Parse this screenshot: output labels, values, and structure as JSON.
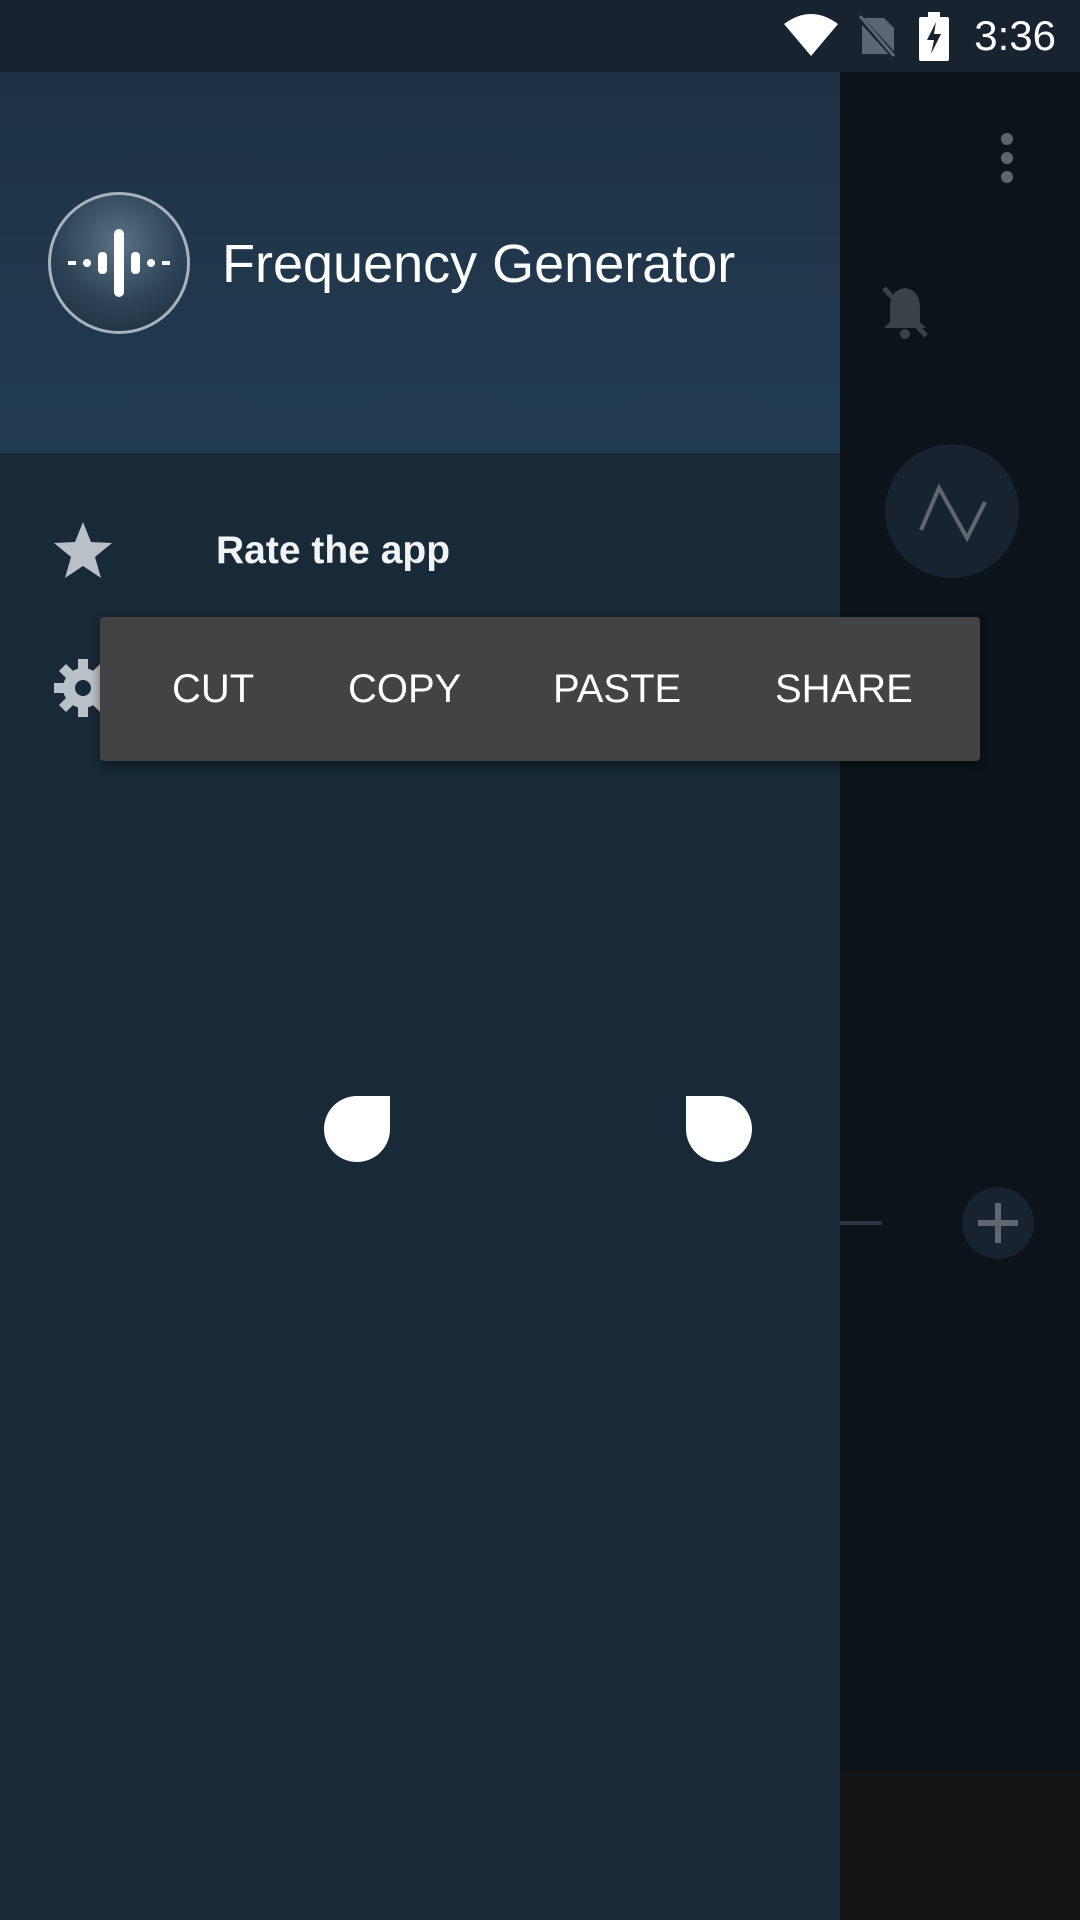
{
  "status_bar": {
    "time": "3:36",
    "icons": [
      "wifi-icon",
      "no-sim-icon",
      "battery-charging-icon"
    ]
  },
  "drawer": {
    "app_name": "Frequency Generator",
    "logo_icon": "soundwave-logo-icon",
    "menu": [
      {
        "label": "Rate the app",
        "icon": "star-icon"
      },
      {
        "label": "",
        "icon": "gear-icon"
      }
    ]
  },
  "context_menu": {
    "cut": "CUT",
    "copy": "COPY",
    "paste": "PASTE",
    "share": "SHARE"
  },
  "background_app": {
    "icons": [
      "more-vert-icon",
      "mute-icon",
      "triangle-wave-icon",
      "add-icon"
    ]
  },
  "colors": {
    "drawer_bg": "#182937",
    "header_bg": "#213b52",
    "toolbar_bg": "#434343",
    "status_bar_bg": "#17232f"
  }
}
